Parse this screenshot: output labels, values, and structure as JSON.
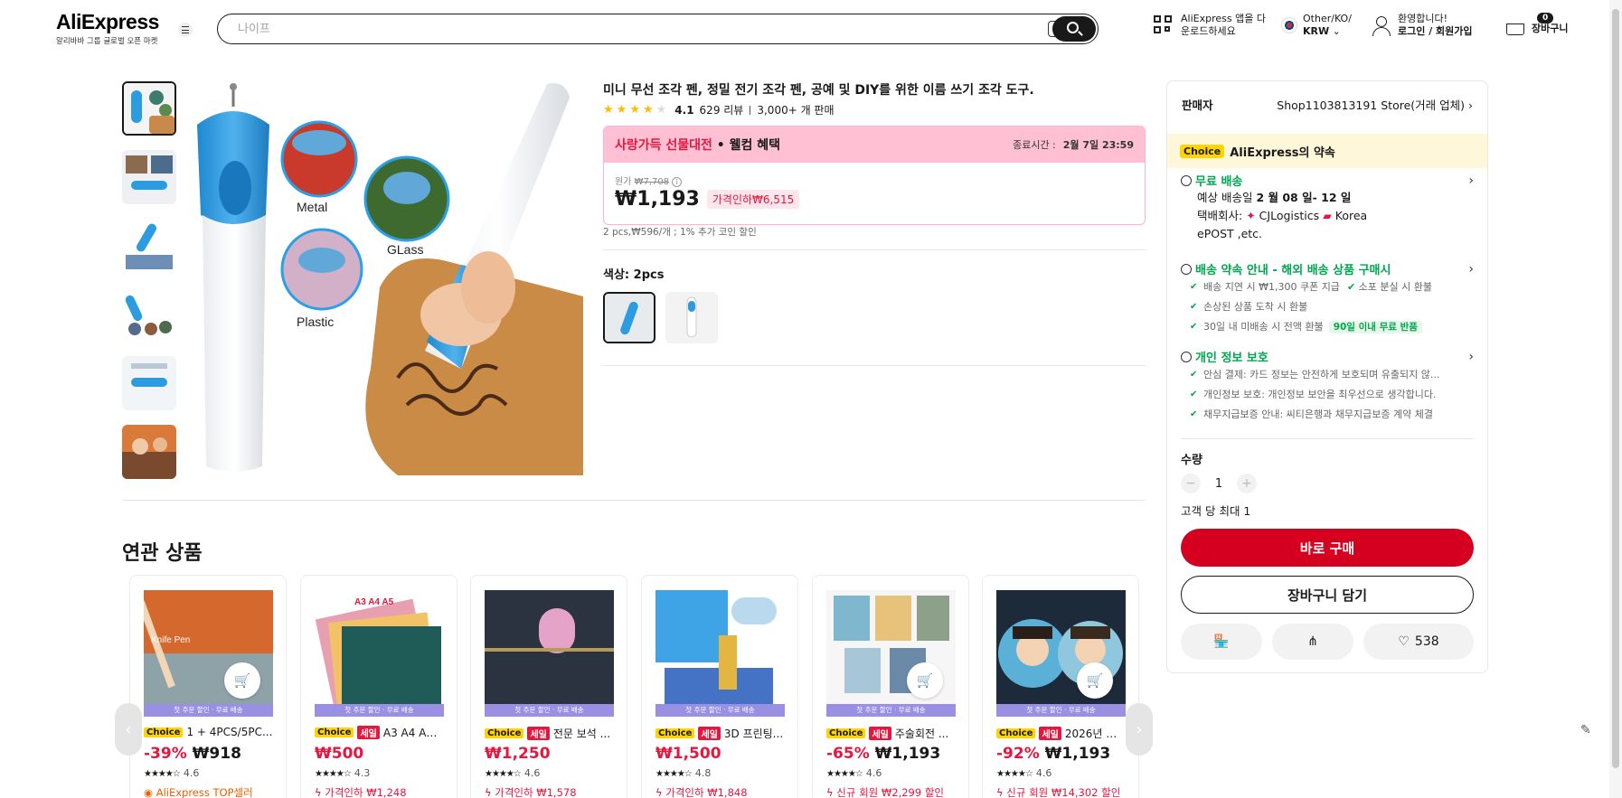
{
  "header": {
    "logo": "AliExpress",
    "logo_tagline": "알리바바 그룹 글로벌 오픈 마켓",
    "search_placeholder": "나이프",
    "app_download_line1": "AliExpress 앱을 다",
    "app_download_line2": "운로드하세요",
    "region_line1": "Other/KO/",
    "region_line2": "KRW",
    "account_line1": "환영합니다!",
    "account_line2": "로그인 / 회원가입",
    "cart_count": "0",
    "cart_label": "장바구니"
  },
  "product": {
    "title": "미니 무선 조각 펜, 정밀 전기 조각 펜, 공예 및 DIY를 위한 이름 쓰기 조각 도구.",
    "rating": "4.1",
    "stars_filled": 4,
    "reviews": "629 리뷰",
    "sold": "3,000+ 개 판매",
    "promo_name_red": "사랑가득 선물대전",
    "promo_name_black": " • 웰컴 혜택",
    "promo_timer_label": "종료시간 :",
    "promo_timer_value": "2월 7일 23:59",
    "orig_label": "원가",
    "orig_price": "₩7,708",
    "price": "₩1,193",
    "discount": "가격인하₩6,515",
    "coin_line": "2 pcs,₩596/개 ; 1% 추가 코인 할인",
    "color_label": "색상: 2pcs",
    "image_labels": {
      "metal": "Metal",
      "glass": "GLass",
      "plastic": "Plastic"
    }
  },
  "panel": {
    "seller_label": "판매자",
    "seller_name": "Shop1103813191 Store(거래 업체)",
    "choice_badge": "Choice",
    "promise": "AliExpress의 약속",
    "shipping_title": "무료 배송",
    "delivery_prefix": "예상 배송일 ",
    "delivery_dates": "2 월 08 일- 12 일",
    "carrier_line1": "택배회사: ",
    "carrier_name1": "CJLogistics",
    "carrier_name2": "Korea",
    "carrier_line2": "ePOST ,etc.",
    "promise_title": "배송 약속 안내 - 해외 배송 상품 구매시",
    "promise_items": [
      {
        "a": "배송 지연 시 ₩1,300 쿠폰 지급",
        "b": "소포 분실 시 환불"
      },
      {
        "a": "손상된 상품 도착 시 환불"
      },
      {
        "a": "30일 내 미배송 시 전액 환불",
        "pill": "90일 이내 무료 반품"
      }
    ],
    "privacy_title": "개인 정보 보호",
    "privacy_items": [
      "안심 결제: 카드 정보는 안전하게 보호되며 유출되지 않...",
      "개인정보 보호: 개인정보 보안을 최우선으로 생각합니다.",
      "채무지급보증 안내: 씨티은행과 채무지급보증 계약 체결"
    ],
    "qty_label": "수량",
    "qty_value": "1",
    "max_line": "고객 당 최대 1",
    "buy_label": "바로 구매",
    "cart_label": "장바구니 담기",
    "wishlist_count": "538"
  },
  "related": {
    "title": "연관 상품",
    "strip_text": "첫 주문 할인 · 무료 배송",
    "cards": [
      {
        "choice": "Choice",
        "sale": "",
        "name": "1 + 4PCS/5PC...",
        "discount": "-39%",
        "price": "₩918",
        "rating": "4.6",
        "extra": "AliExpress TOP셀러",
        "extra_type": "store",
        "img_label": "Knife Pen"
      },
      {
        "choice": "Choice",
        "sale": "세일",
        "name": "A3 A4 A5 ...",
        "discount": "",
        "price": "₩500",
        "rating": "4.3",
        "extra": "가격인하 ₩1,248",
        "extra_type": "red",
        "img_label": "A3 A4 A5"
      },
      {
        "choice": "Choice",
        "sale": "세일",
        "name": "전문 보석 ...",
        "discount": "",
        "price": "₩1,250",
        "rating": "4.6",
        "extra": "가격인하 ₩1,578",
        "extra_type": "red",
        "img_label": ""
      },
      {
        "choice": "Choice",
        "sale": "세일",
        "name": "3D 프린팅...",
        "discount": "",
        "price": "₩1,500",
        "rating": "4.8",
        "extra": "가격인하 ₩1,848",
        "extra_type": "red",
        "img_label": ""
      },
      {
        "choice": "Choice",
        "sale": "세일",
        "name": "주술회전 ...",
        "discount": "-65%",
        "price": "₩1,193",
        "rating": "4.6",
        "extra": "신규 회원 ₩2,299 할인",
        "extra_type": "red",
        "img_label": ""
      },
      {
        "choice": "Choice",
        "sale": "세일",
        "name": "2026년 신...",
        "discount": "-92%",
        "price": "₩1,193",
        "rating": "4.6",
        "extra": "신규 회원 ₩14,302 할인",
        "extra_type": "red",
        "img_label": ""
      }
    ]
  },
  "colors": {
    "accent_red": "#d5001f",
    "green": "#00a650",
    "choice_yellow": "#ffd400",
    "promo_pink": "#ffc0d4"
  }
}
